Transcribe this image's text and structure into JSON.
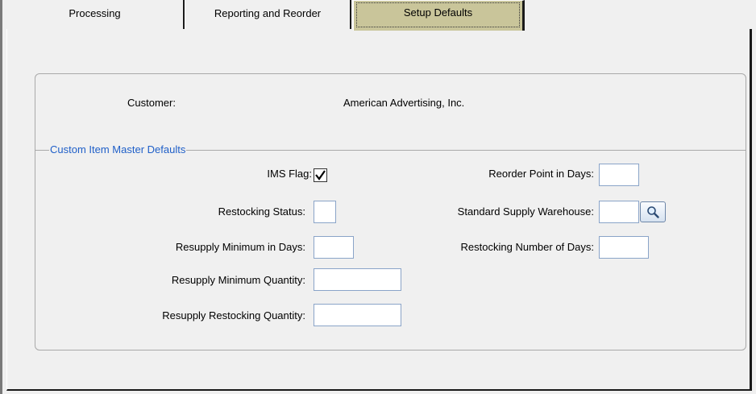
{
  "tabs": [
    {
      "label": "Processing",
      "active": false
    },
    {
      "label": "Reporting and Reorder",
      "active": false
    },
    {
      "label": "Setup Defaults",
      "active": true
    }
  ],
  "customer": {
    "label": "Customer:",
    "value": "American Advertising, Inc."
  },
  "section": {
    "title": "Custom Item Master Defaults"
  },
  "fields": {
    "ims_flag": {
      "label": "IMS Flag:",
      "checked": true
    },
    "restocking_status": {
      "label": "Restocking Status:",
      "value": ""
    },
    "resupply_min_days": {
      "label": "Resupply Minimum in Days:",
      "value": ""
    },
    "resupply_min_qty": {
      "label": "Resupply Minimum Quantity:",
      "value": ""
    },
    "resupply_restock_qty": {
      "label": "Resupply Restocking Quantity:",
      "value": ""
    },
    "reorder_point_days": {
      "label": "Reorder Point in Days:",
      "value": ""
    },
    "std_supply_warehouse": {
      "label": "Standard Supply Warehouse:",
      "value": ""
    },
    "restocking_num_days": {
      "label": "Restocking Number of Days:",
      "value": ""
    }
  },
  "icons": {
    "lookup": "magnifier-icon",
    "check": "checkmark-icon"
  },
  "colors": {
    "active_tab": "#c9c59a",
    "section_title": "#1f5fc8",
    "field_border": "#8aa4c8",
    "background": "#f0f0f0"
  }
}
